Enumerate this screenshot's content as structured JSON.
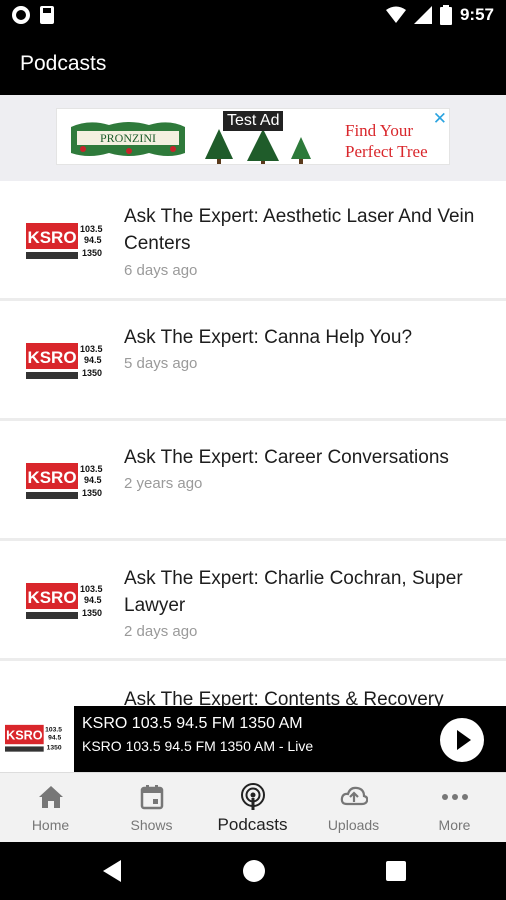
{
  "status_bar": {
    "time": "9:57"
  },
  "app_bar": {
    "title": "Podcasts"
  },
  "ad": {
    "label": "Test Ad",
    "brand": "PRONZINI",
    "copy_line1": "Find Your",
    "copy_line2": "Perfect Tree",
    "close": "✕"
  },
  "station_logo": {
    "call_letters": "KSRO",
    "freq1": "103.5",
    "freq2": "94.5",
    "freq3": "1350"
  },
  "podcasts": [
    {
      "title": "Ask The Expert: Aesthetic Laser And Vein Centers",
      "time": "6 days ago"
    },
    {
      "title": "Ask The Expert: Canna Help You?",
      "time": "5 days ago"
    },
    {
      "title": "Ask The Expert: Career Conversations",
      "time": "2 years ago"
    },
    {
      "title": "Ask The Expert: Charlie Cochran, Super Lawyer",
      "time": "2 days ago"
    },
    {
      "title": "Ask The Expert: Contents & Recovery",
      "time": ""
    }
  ],
  "mini_player": {
    "title": "KSRO 103.5 94.5 FM 1350 AM",
    "subtitle": "KSRO 103.5 94.5 FM 1350 AM - Live"
  },
  "nav": [
    {
      "label": "Home",
      "icon": "home-icon"
    },
    {
      "label": "Shows",
      "icon": "calendar-icon"
    },
    {
      "label": "Podcasts",
      "icon": "podcast-icon",
      "active": true
    },
    {
      "label": "Uploads",
      "icon": "upload-cloud-icon"
    },
    {
      "label": "More",
      "icon": "more-dots-icon"
    }
  ],
  "colors": {
    "brand_red": "#d9262b",
    "ad_close": "#2aa3e0",
    "bar_black": "#000000"
  }
}
